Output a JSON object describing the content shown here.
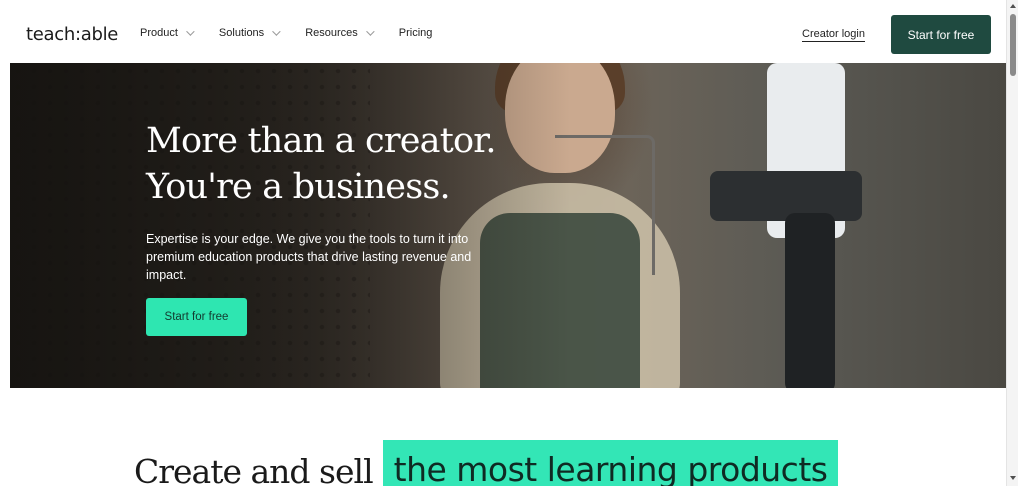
{
  "nav": {
    "logo": "teach:able",
    "items": [
      {
        "label": "Product",
        "dropdown": true
      },
      {
        "label": "Solutions",
        "dropdown": true
      },
      {
        "label": "Resources",
        "dropdown": true
      },
      {
        "label": "Pricing",
        "dropdown": false
      }
    ],
    "login_label": "Creator login",
    "cta_label": "Start for free"
  },
  "hero": {
    "title_line1": "More than a creator.",
    "title_line2": "You're a business.",
    "description": "Expertise is your edge. We give you the tools to turn it into premium education products that drive lasting revenue and impact.",
    "cta_label": "Start for free"
  },
  "section": {
    "headline_plain": "Create and sell",
    "headline_highlight": "the most learning products"
  },
  "colors": {
    "brand_dark": "#1f4a40",
    "accent_green": "#2ee6b1"
  }
}
